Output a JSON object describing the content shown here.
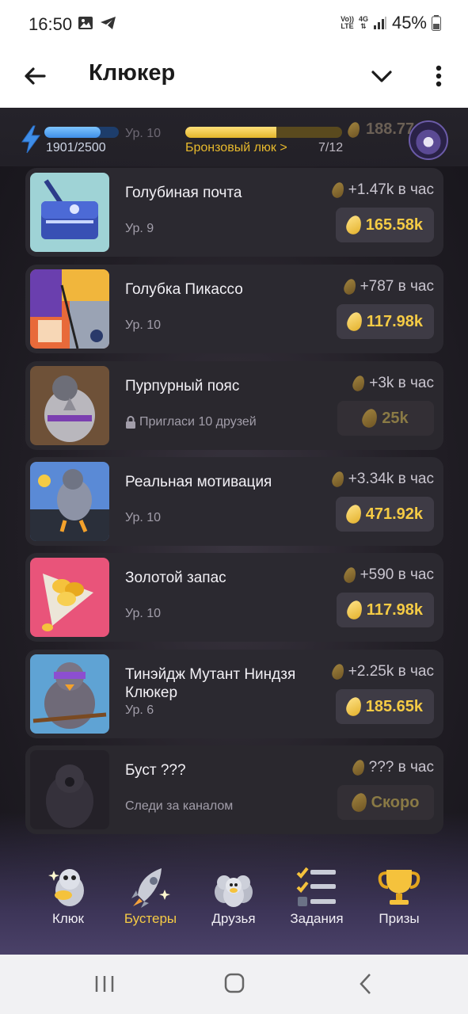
{
  "status_bar": {
    "time": "16:50",
    "network_top": "Vo))",
    "network_bottom": "LTE",
    "net_type": "4G",
    "battery": "45%"
  },
  "app_bar": {
    "title": "Клюкер",
    "back_icon": "arrow-left-icon",
    "chevron_icon": "chevron-down-icon",
    "menu_icon": "more-vertical-icon"
  },
  "hud": {
    "energy": "1901/2500",
    "energy_fraction": 0.76,
    "level": "Ур. 10",
    "rank_label": "Бронзовый люк >",
    "rank_progress": "7/12",
    "rank_fraction": 0.583,
    "balance": "188.77"
  },
  "cards": [
    {
      "title": "Голубиная почта",
      "sub": "Ур. 9",
      "rate": "+1.47k в час",
      "price": "165.58k",
      "locked": false
    },
    {
      "title": "Голубка Пикассо",
      "sub": "Ур. 10",
      "rate": "+787 в час",
      "price": "117.98k",
      "locked": false
    },
    {
      "title": "Пурпурный пояс",
      "sub": "Пригласи 10 друзей",
      "rate": "+3k в час",
      "price": "25k",
      "locked": true
    },
    {
      "title": "Реальная мотивация",
      "sub": "Ур. 10",
      "rate": "+3.34k в час",
      "price": "471.92k",
      "locked": false
    },
    {
      "title": "Золотой запас",
      "sub": "Ур. 10",
      "rate": "+590 в час",
      "price": "117.98k",
      "locked": false
    },
    {
      "title": "Тинэйдж Мутант Ниндзя Клюкер",
      "sub": "Ур. 6",
      "rate": "+2.25k в час",
      "price": "185.65k",
      "locked": false
    },
    {
      "title": "Буст ???",
      "sub": "Следи за каналом",
      "rate": "??? в час",
      "price": "Скоро",
      "locked": true
    }
  ],
  "bottom_nav": [
    {
      "label": "Клюк",
      "icon": "pigeon-icon",
      "active": false
    },
    {
      "label": "Бустеры",
      "icon": "rocket-icon",
      "active": true
    },
    {
      "label": "Друзья",
      "icon": "friends-icon",
      "active": false
    },
    {
      "label": "Задания",
      "icon": "tasks-icon",
      "active": false
    },
    {
      "label": "Призы",
      "icon": "trophy-icon",
      "active": false
    }
  ],
  "colors": {
    "accent": "#f5cb45",
    "card_bg": "#2b2930",
    "energy": "#4a9cf0"
  }
}
